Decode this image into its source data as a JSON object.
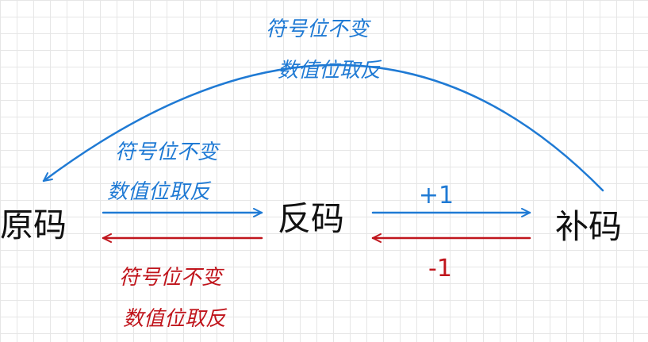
{
  "colors": {
    "blue": "#1f7ad4",
    "red": "#c0151c",
    "ink": "#111111",
    "grid": "#e6e6e6"
  },
  "nodes": {
    "original_code": "原码",
    "ones_complement": "反码",
    "twos_complement": "补码"
  },
  "annotations": {
    "top_arc_line1": "符号位不变",
    "top_arc_line2": "数值位取反",
    "left_blue_line1": "符号位不变",
    "left_blue_line2": "数值位取反",
    "left_red_line1": "符号位不变",
    "left_red_line2": "数值位取反",
    "right_blue_op": "+1",
    "right_red_op": "-1"
  }
}
